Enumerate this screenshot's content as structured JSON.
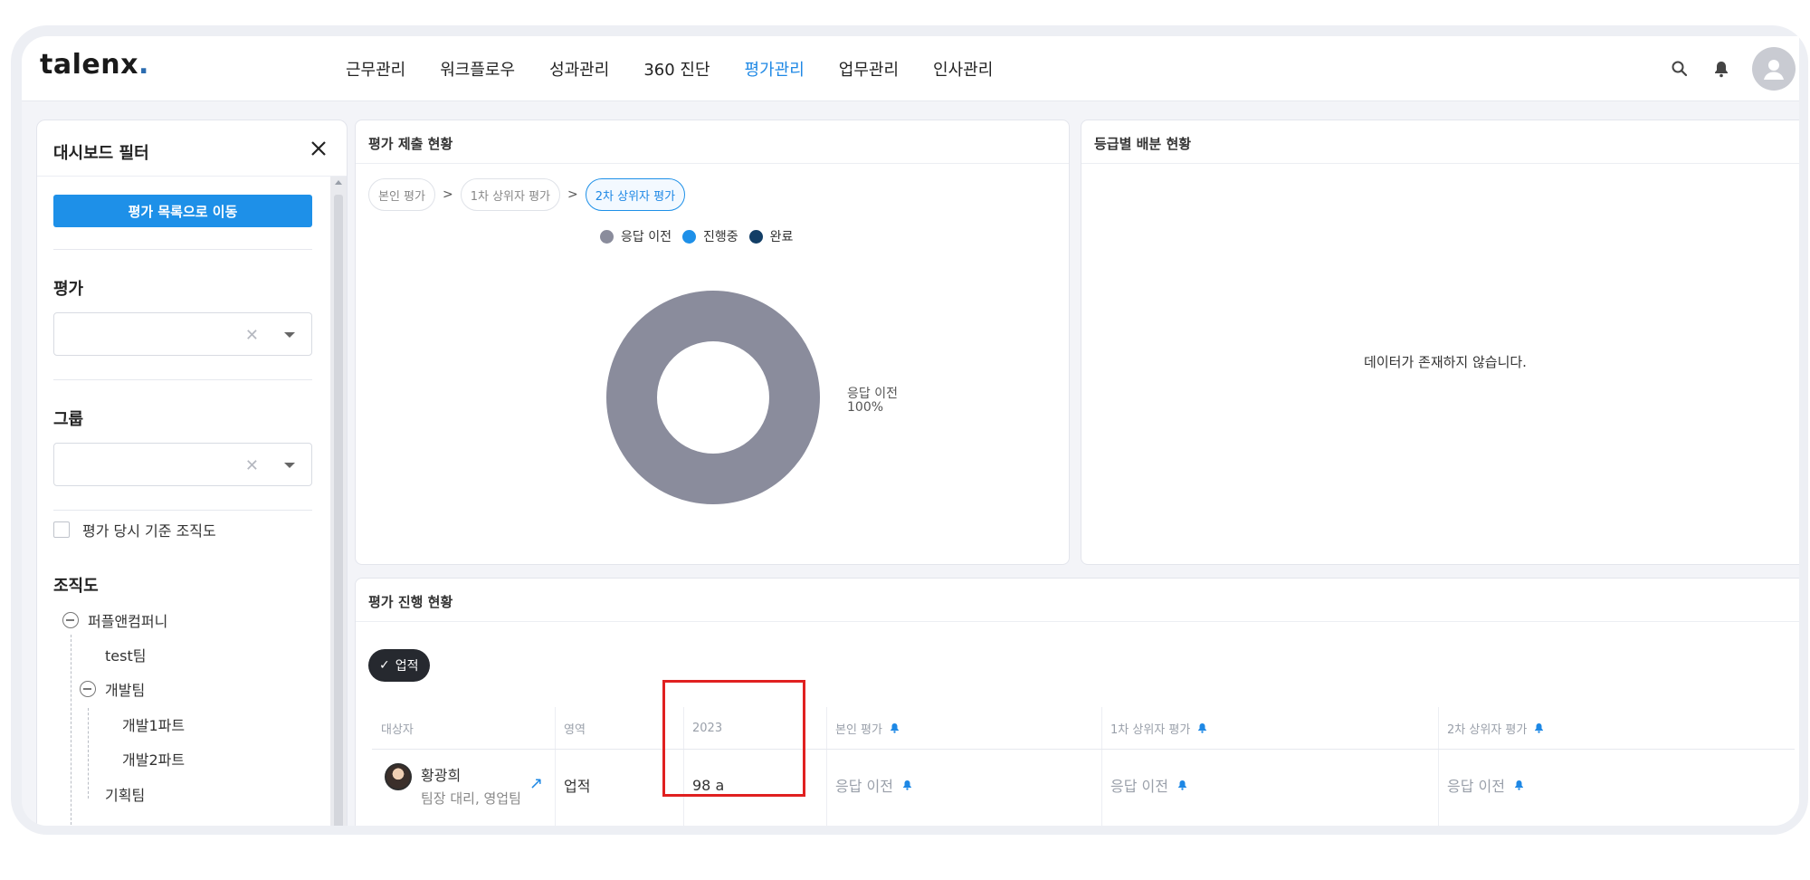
{
  "brand": {
    "name": "talenx",
    "dot": "."
  },
  "nav": {
    "items": [
      "근무관리",
      "워크플로우",
      "성과관리",
      "360 진단",
      "평가관리",
      "업무관리",
      "인사관리"
    ],
    "active_index": 4
  },
  "sidebar": {
    "title": "대시보드 필터",
    "primary_button": "평가 목록으로 이동",
    "eval_label": "평가",
    "group_label": "그룹",
    "clear_symbol": "✕",
    "checkbox_label": "평가 당시 기준 조직도",
    "org_label": "조직도",
    "tree": [
      "퍼플앤컴퍼니",
      "test팀",
      "개발팀",
      "개발1파트",
      "개발2파트",
      "기획팀"
    ]
  },
  "submission_panel": {
    "title": "평가 제출 현황",
    "steps": [
      "본인 평가",
      "1차 상위자 평가",
      "2차 상위자 평가"
    ],
    "active_step": 2,
    "separator": ">",
    "legend": [
      "응답 이전",
      "진행중",
      "완료"
    ],
    "donut_label": "응답 이전",
    "donut_percent": "100%"
  },
  "grade_panel": {
    "title": "등급별 배분 현황",
    "empty_message": "데이터가 존재하지 않습니다."
  },
  "progress_panel": {
    "title": "평가 진행 현황",
    "filter_tag": "업적",
    "check_symbol": "✓",
    "columns": [
      "대상자",
      "영역",
      "2023",
      "본인 평가",
      "1차 상위자 평가",
      "2차 상위자 평가"
    ],
    "row": {
      "name": "황광희",
      "position": "팀장 대리, 영업팀",
      "area": "업적",
      "score": "98 a",
      "self_status": "응답 이전",
      "first_status": "응답 이전",
      "second_status": "응답 이전"
    }
  },
  "chart_data": {
    "type": "pie",
    "title": "",
    "categories": [
      "응답 이전",
      "진행중",
      "완료"
    ],
    "values": [
      100,
      0,
      0
    ],
    "colors": [
      "#8a8c9c",
      "#1e90e8",
      "#123e66"
    ],
    "legend": "top"
  },
  "colors": {
    "accent": "#1e88e5",
    "highlight": "#e02020"
  },
  "icons": [
    "search-icon",
    "bell-icon",
    "user-avatar-icon",
    "close-icon",
    "chevron-down-icon",
    "minus-circle-icon",
    "external-link-icon"
  ]
}
